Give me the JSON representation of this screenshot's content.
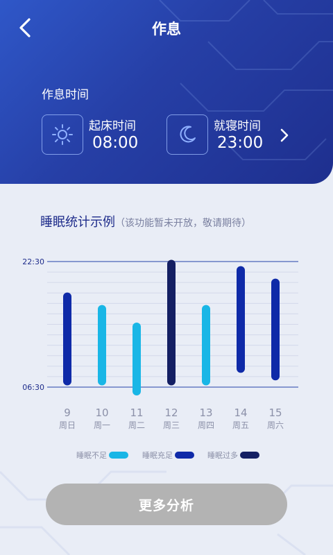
{
  "header": {
    "title": "作息"
  },
  "schedule": {
    "section_title": "作息时间",
    "wake": {
      "label": "起床时间",
      "time": "08:00",
      "icon": "sun-icon"
    },
    "sleep": {
      "label": "就寝时间",
      "time": "23:00",
      "icon": "moon-icon"
    }
  },
  "stats": {
    "title": "睡眠统计示例",
    "note": "（该功能暂未开放，敬请期待）"
  },
  "chart_data": {
    "type": "bar",
    "subtype": "range-bar",
    "y_ticks": [
      "22:30",
      "06:30"
    ],
    "categories": [
      {
        "day": "9",
        "weekday": "周日"
      },
      {
        "day": "10",
        "weekday": "周一"
      },
      {
        "day": "11",
        "weekday": "周二"
      },
      {
        "day": "12",
        "weekday": "周三"
      },
      {
        "day": "13",
        "weekday": "周四"
      },
      {
        "day": "14",
        "weekday": "周五"
      },
      {
        "day": "15",
        "weekday": "周六"
      }
    ],
    "bars": [
      {
        "start": 0.08,
        "end": 0.82,
        "status": "sufficient"
      },
      {
        "start": 0.08,
        "end": 0.72,
        "status": "insufficient"
      },
      {
        "start": 0.0,
        "end": 0.58,
        "status": "insufficient"
      },
      {
        "start": 0.08,
        "end": 1.08,
        "status": "excess"
      },
      {
        "start": 0.08,
        "end": 0.72,
        "status": "insufficient"
      },
      {
        "start": 0.18,
        "end": 1.03,
        "status": "sufficient"
      },
      {
        "start": 0.12,
        "end": 0.93,
        "status": "sufficient"
      }
    ],
    "legend": [
      {
        "key": "insufficient",
        "label": "睡眠不足",
        "color": "#19b6e6"
      },
      {
        "key": "sufficient",
        "label": "睡眠充足",
        "color": "#0f2aa8"
      },
      {
        "key": "excess",
        "label": "睡眠过多",
        "color": "#141f63"
      }
    ],
    "grid": true
  },
  "actions": {
    "more_label": "更多分析"
  },
  "colors": {
    "header_start": "#2f57c8",
    "header_end": "#1e2f8e",
    "accent": "#1d2b8a",
    "button_disabled": "#b3b3b3"
  }
}
